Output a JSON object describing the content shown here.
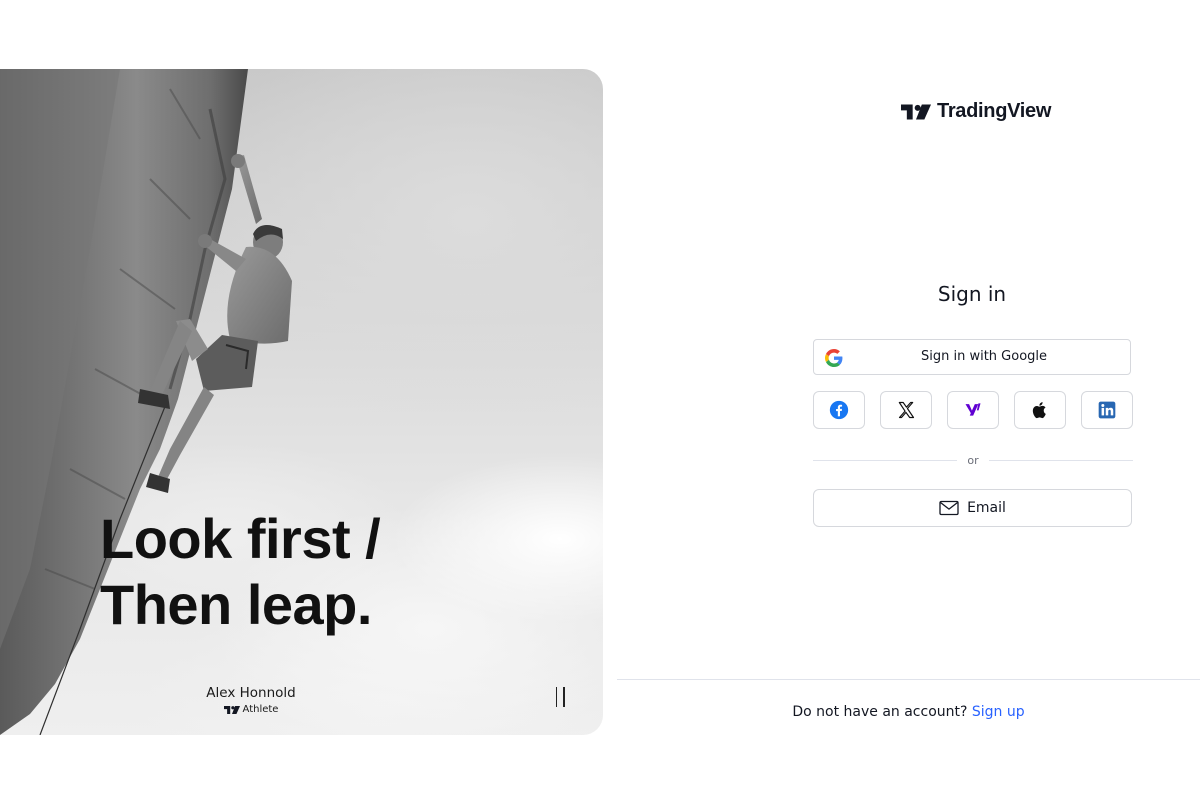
{
  "hero": {
    "headline_line1": "Look first /",
    "headline_line2": "Then leap.",
    "person_name": "Alex Honnold",
    "person_role": "Athlete",
    "photo": "black-and-white rock climber on cliff face"
  },
  "brand": {
    "name": "TradingView",
    "logo_icon": "tradingview-logo-icon"
  },
  "signin": {
    "title": "Sign in",
    "google_label": "Sign in with Google",
    "social_buttons": [
      {
        "name": "facebook",
        "icon": "facebook-icon",
        "color": "#1877f2"
      },
      {
        "name": "x",
        "icon": "x-icon",
        "color": "#000000"
      },
      {
        "name": "yahoo",
        "icon": "yahoo-icon",
        "color": "#6001d2"
      },
      {
        "name": "apple",
        "icon": "apple-icon",
        "color": "#000000"
      },
      {
        "name": "linkedin",
        "icon": "linkedin-icon",
        "color": "#2867b2"
      }
    ],
    "divider_text": "or",
    "email_label": "Email"
  },
  "footer": {
    "prompt": "Do not have an account?",
    "signup_link": "Sign up"
  },
  "colors": {
    "link": "#2962ff",
    "text": "#131722",
    "border": "#d6d8dd"
  }
}
